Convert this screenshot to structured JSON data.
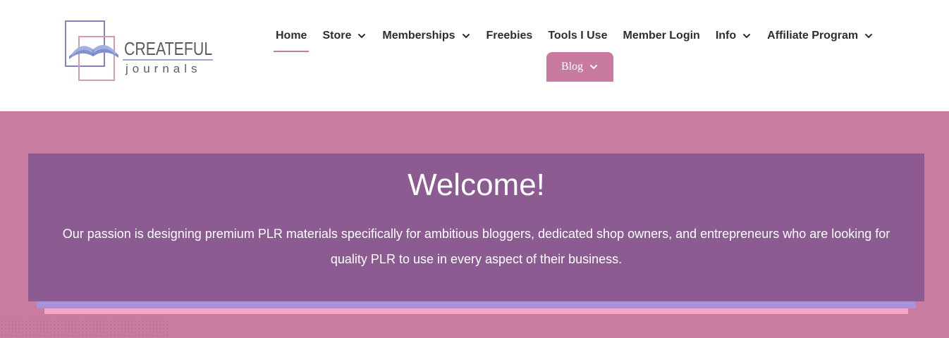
{
  "brand": {
    "line1": "CREATEFUL",
    "line2": "journals"
  },
  "nav": {
    "items": [
      {
        "label": "Home",
        "active": true,
        "dropdown": false
      },
      {
        "label": "Store",
        "dropdown": true
      },
      {
        "label": "Memberships",
        "dropdown": true
      },
      {
        "label": "Freebies",
        "dropdown": false
      },
      {
        "label": "Tools I Use",
        "dropdown": false
      },
      {
        "label": "Member Login",
        "dropdown": false
      },
      {
        "label": "Info",
        "dropdown": true
      },
      {
        "label": "Affiliate Program",
        "dropdown": true
      }
    ],
    "blog_label": "Blog"
  },
  "hero": {
    "title": "Welcome!",
    "body": "Our passion is designing premium PLR materials specifically for ambitious bloggers, dedicated shop owners, and entrepreneurs who are looking for quality PLR to use in every aspect of their business."
  },
  "colors": {
    "accent_pink": "#c97aa0",
    "card_purple": "#8b5b92",
    "lavender": "#a892d8",
    "light_pink": "#f2a6c8"
  },
  "icons": {
    "dropdown": "chevron-down-icon",
    "logo": "open-book-icon"
  }
}
